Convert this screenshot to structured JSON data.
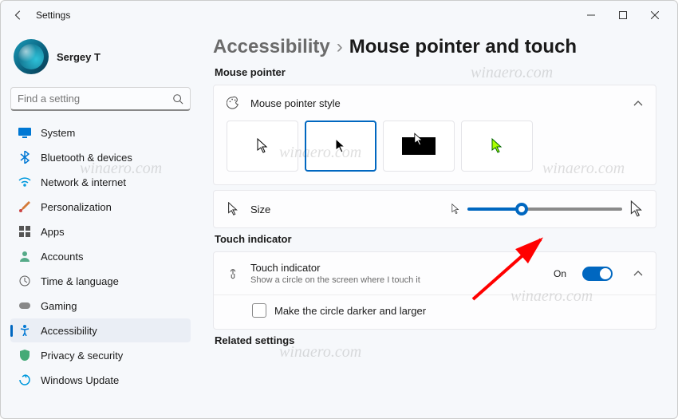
{
  "window": {
    "title": "Settings"
  },
  "profile": {
    "name": "Sergey T"
  },
  "search": {
    "placeholder": "Find a setting"
  },
  "nav": {
    "items": [
      {
        "label": "System"
      },
      {
        "label": "Bluetooth & devices"
      },
      {
        "label": "Network & internet"
      },
      {
        "label": "Personalization"
      },
      {
        "label": "Apps"
      },
      {
        "label": "Accounts"
      },
      {
        "label": "Time & language"
      },
      {
        "label": "Gaming"
      },
      {
        "label": "Accessibility"
      },
      {
        "label": "Privacy & security"
      },
      {
        "label": "Windows Update"
      }
    ]
  },
  "breadcrumb": {
    "parent": "Accessibility",
    "sep": "›",
    "current": "Mouse pointer and touch"
  },
  "sections": {
    "pointer": "Mouse pointer",
    "style_title": "Mouse pointer style",
    "size_title": "Size",
    "touch": "Touch indicator",
    "touch_title": "Touch indicator",
    "touch_sub": "Show a circle on the screen where I touch it",
    "touch_state": "On",
    "touch_sub_option": "Make the circle darker and larger",
    "related": "Related settings"
  },
  "slider": {
    "value": 35,
    "min": 0,
    "max": 100
  },
  "watermark": "winaero.com",
  "colors": {
    "accent": "#0067c0"
  }
}
